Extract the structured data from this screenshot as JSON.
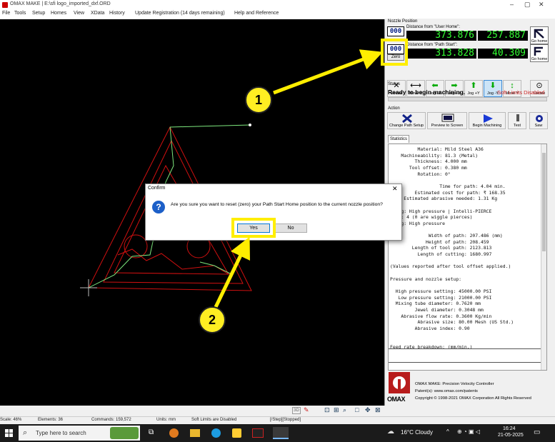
{
  "window": {
    "title": "OMAX MAKE | E:\\sfi logo_imported_dxf.ORD",
    "minimize": "–",
    "restore": "▢",
    "close": "✕"
  },
  "menu": [
    "File",
    "Tools",
    "Setup",
    "Homes",
    "View",
    "XData",
    "History",
    "Update Registration (14 days remaining)",
    "Help and Reference"
  ],
  "nozzle": {
    "group_label": "Nozzle Position",
    "user_home_label": "Distance from \"User Home\":",
    "user_home_x": "373.876",
    "user_home_y": "257.887",
    "path_start_label": "Distance from \"Path Start\":",
    "path_start_x": "313.828",
    "path_start_y": "40.309",
    "btn_000": "000",
    "zero_label": "Zero",
    "go_home": "Go home"
  },
  "jog_buttons": [
    {
      "label": "Vector",
      "icon": "✕"
    },
    {
      "label": "Move X",
      "icon": "⟷"
    },
    {
      "label": "Jog -X",
      "icon": "⬅"
    },
    {
      "label": "Jog +X",
      "icon": "➡"
    },
    {
      "label": "Jog +Y",
      "icon": "⬆"
    },
    {
      "label": "Jog -Y",
      "icon": "⬇"
    },
    {
      "label": "Move Y",
      "icon": "↕"
    },
    {
      "label": "Locate",
      "icon": "⊙"
    }
  ],
  "status": {
    "group_label": "Status",
    "text": "Ready to begin machining.",
    "limits": "Soft Limits Disabled"
  },
  "action": {
    "group_label": "Action",
    "buttons": [
      "Change Path Setup",
      "Preview to Screen",
      "Begin Machining",
      "Test",
      "Saw"
    ]
  },
  "statistics": {
    "tab": "Statistics",
    "lines": [
      "          Material: Mild Steel A36",
      "    Machineability: 81.3 (Metal)",
      "         Thickness: 4.000 mm",
      "       Tool offset: 0.380 mm",
      "          Rotation: 0°",
      "",
      "                  Time for path: 4.04 min.",
      "         Estimated cost for path: ₹ 168.35",
      "     Estimated abrasive needed: 1.31 Kg",
      "",
      "rcing: High pressure | Intelli-PIERCE",
      "rces: 4 (0 are wiggle pierces)",
      "tting: High pressure",
      "",
      "              Width of path: 207.486 (mm)",
      "             Height of path: 208.459",
      "        Length of tool path: 2123.813",
      "          Length of cutting: 1680.997",
      "",
      "(Values reported after tool offset applied.)",
      "",
      "Pressure and nozzle setup:",
      "",
      "  High pressure setting: 45000.00 PSI",
      "   Low pressure setting: 21000.00 PSI",
      "  Mixing tube diameter: 0.7620 mm",
      "         Jewel diameter: 0.3048 mm",
      "    Abrasive flow rate: 0.3600 Kg/min",
      "          Abrasive size: 80.00 Mesh (US Std.)",
      "         Abrasive index: 0.90",
      "",
      "",
      "Feed rate breakdown: (mm/min.)"
    ]
  },
  "about": {
    "line1": "OMAX MAKE: Precision Velocity Controller",
    "line2": "Patent(s): www.omax.com/patents",
    "line3": "Copyright © 1998-2021 OMAX Corporation All Rights Reserved",
    "logo_text": "OMAX"
  },
  "statusbar": {
    "scale": "Scale: 46%",
    "elements": "Elements: 36",
    "commands": "Commands: 159,572",
    "units": "Units: mm",
    "limits": "Soft Limits are Disabled",
    "step": "[/Step][Stopped]",
    "view3d": "3D"
  },
  "dialog": {
    "title": "Confirm",
    "message": "Are you sure you want to reset (zero) your Path Start Home position to the current nozzle position?",
    "yes": "Yes",
    "no": "No",
    "close": "✕"
  },
  "callouts": [
    "1",
    "2"
  ],
  "taskbar": {
    "search_placeholder": "Type here to search",
    "weather": "16°C  Cloudy",
    "time": "16:24",
    "date": "21-05-2025"
  },
  "colors": {
    "dro_text": "#33ff33",
    "highlight": "#ffee00",
    "path_red": "#d01010",
    "path_green": "#7ee87e",
    "limits_red": "#cc2222"
  }
}
